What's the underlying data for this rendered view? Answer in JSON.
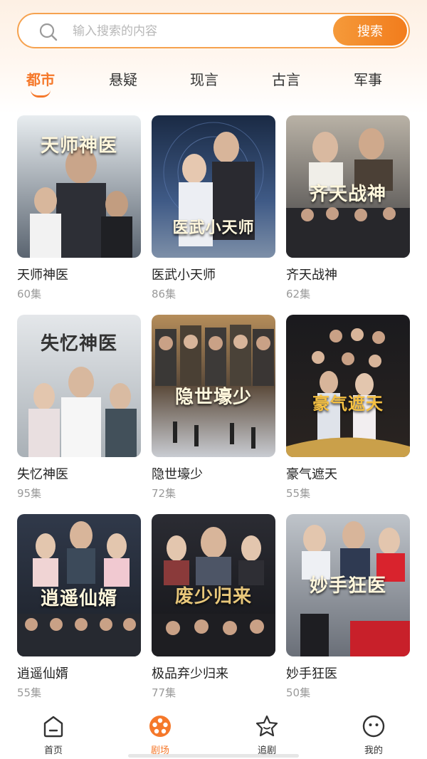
{
  "search": {
    "placeholder": "输入搜索的内容",
    "button_label": "搜索"
  },
  "categories": [
    "都市",
    "悬疑",
    "现言",
    "古言",
    "军事"
  ],
  "active_category": "都市",
  "dramas": [
    {
      "title": "天师神医",
      "episodes": "60集",
      "poster_text": "天师神医"
    },
    {
      "title": "医武小天师",
      "episodes": "86集",
      "poster_text": "医武小天师"
    },
    {
      "title": "齐天战神",
      "episodes": "62集",
      "poster_text": "齐天战神"
    },
    {
      "title": "失忆神医",
      "episodes": "95集",
      "poster_text": "失忆神医"
    },
    {
      "title": "隐世壕少",
      "episodes": "72集",
      "poster_text": "隐世壕少"
    },
    {
      "title": "豪气遮天",
      "episodes": "55集",
      "poster_text": "豪气遮天"
    },
    {
      "title": "逍遥仙婿",
      "episodes": "55集",
      "poster_text": "逍遥仙婿"
    },
    {
      "title": "极品弃少归来",
      "episodes": "77集",
      "poster_text": "废少归来"
    },
    {
      "title": "妙手狂医",
      "episodes": "50集",
      "poster_text": "妙手狂医"
    }
  ],
  "bottom_nav": [
    {
      "label": "首页",
      "icon": "home-icon"
    },
    {
      "label": "剧场",
      "icon": "film-reel-icon"
    },
    {
      "label": "追剧",
      "icon": "star-icon"
    },
    {
      "label": "我的",
      "icon": "face-icon"
    }
  ],
  "colors": {
    "accent": "#f5782a",
    "search_border": "#f6a24f"
  }
}
